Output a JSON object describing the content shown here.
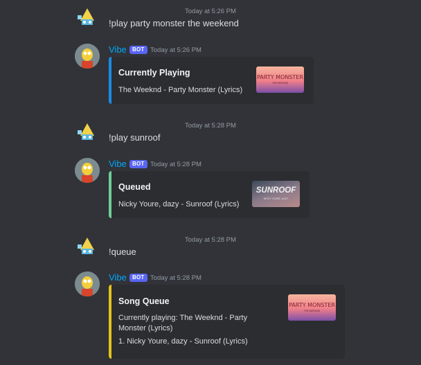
{
  "messages": [
    {
      "type": "user",
      "timestamp": "Today at 5:26 PM",
      "text": "!play party monster the weekend"
    },
    {
      "type": "bot",
      "username": "Vibe",
      "tag": "BOT",
      "timestamp": "Today at 5:26 PM",
      "embed": {
        "title": "Currently Playing",
        "desc": "The Weeknd - Party Monster (Lyrics)",
        "color": "#1a8ce6",
        "thumb": {
          "title": "PARTY MONSTER",
          "sub": "THE WEEKND"
        }
      }
    },
    {
      "type": "user",
      "timestamp": "Today at 5:28 PM",
      "text": "!play sunroof"
    },
    {
      "type": "bot",
      "username": "Vibe",
      "tag": "BOT",
      "timestamp": "Today at 5:28 PM",
      "embed": {
        "title": "Queued",
        "desc": "Nicky Youre, dazy - Sunroof (Lyrics)",
        "color": "#6fcf97",
        "thumb": {
          "title": "SUNROOF",
          "sub": "NICKY YOURE, DAZY"
        }
      }
    },
    {
      "type": "user",
      "timestamp": "Today at 5:28 PM",
      "text": "!queue"
    },
    {
      "type": "bot",
      "username": "Vibe",
      "tag": "BOT",
      "timestamp": "Today at 5:28 PM",
      "embed": {
        "title": "Song Queue",
        "desc_lines": [
          "Currently playing: The Weeknd - Party",
          "Monster (Lyrics)",
          "1. Nicky Youre, dazy - Sunroof (Lyrics)"
        ],
        "color": "#e5c21a",
        "thumb": {
          "title": "PARTY MONSTER",
          "sub": "THE WEEKND"
        }
      }
    }
  ]
}
